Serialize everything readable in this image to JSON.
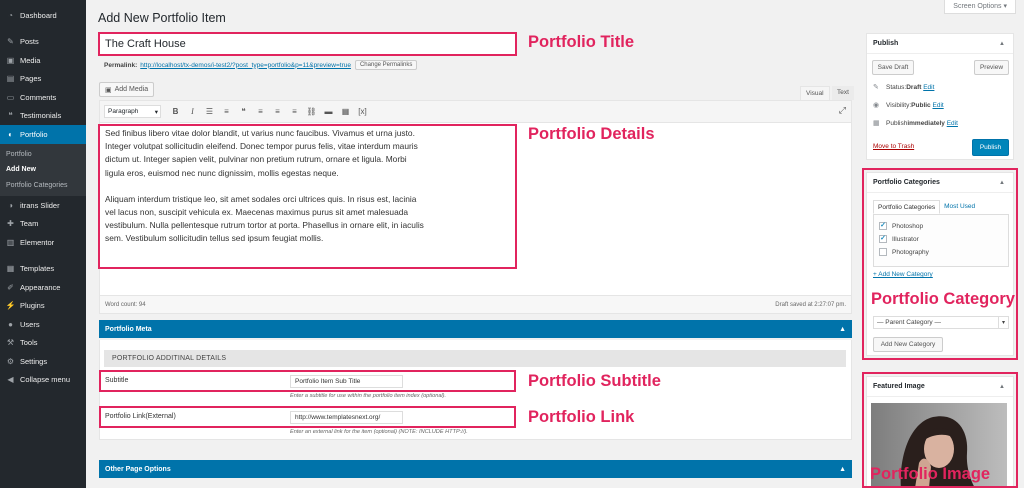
{
  "sidebar": {
    "items": [
      {
        "label": "Dashboard",
        "icon": "dashboard-icon",
        "glyph": "◔"
      },
      {
        "label": "Posts",
        "icon": "pin-icon",
        "glyph": "✎"
      },
      {
        "label": "Media",
        "icon": "media-icon",
        "glyph": "▣"
      },
      {
        "label": "Pages",
        "icon": "page-icon",
        "glyph": "▤"
      },
      {
        "label": "Comments",
        "icon": "comment-icon",
        "glyph": "▭"
      },
      {
        "label": "Testimonials",
        "icon": "testimonial-icon",
        "glyph": "❝"
      },
      {
        "label": "Portfolio",
        "icon": "portfolio-icon",
        "glyph": "◐"
      },
      {
        "label": "itrans Slider",
        "icon": "slider-icon",
        "glyph": "◑"
      },
      {
        "label": "Team",
        "icon": "team-icon",
        "glyph": "✚"
      },
      {
        "label": "Elementor",
        "icon": "elementor-icon",
        "glyph": "▥"
      },
      {
        "label": "Templates",
        "icon": "templates-icon",
        "glyph": "▦"
      },
      {
        "label": "Appearance",
        "icon": "brush-icon",
        "glyph": "✐"
      },
      {
        "label": "Plugins",
        "icon": "plug-icon",
        "glyph": "⚡"
      },
      {
        "label": "Users",
        "icon": "user-icon",
        "glyph": "●"
      },
      {
        "label": "Tools",
        "icon": "wrench-icon",
        "glyph": "⚒"
      },
      {
        "label": "Settings",
        "icon": "settings-icon",
        "glyph": "⚙"
      },
      {
        "label": "Collapse menu",
        "icon": "collapse-icon",
        "glyph": "◀"
      }
    ],
    "submenu": [
      "Portfolio",
      "Add New",
      "Portfolio Categories"
    ]
  },
  "header": {
    "title": "Add New Portfolio Item",
    "screen_options": "Screen Options ▾"
  },
  "post": {
    "title": "The Craft House",
    "permalink_label": "Permalink:",
    "permalink_url": "http://localhost/tx-demos/i-test2/?post_type=portfolio&p=11&preview=true",
    "change_permalinks": "Change Permalinks"
  },
  "editor": {
    "add_media": "Add Media",
    "tab_visual": "Visual",
    "tab_text": "Text",
    "format": "Paragraph",
    "paragraphs": [
      "Sed finibus libero vitae dolor blandit, ut varius nunc faucibus. Vivamus et urna justo. Integer volutpat sollicitudin eleifend. Donec tempor purus felis, vitae interdum mauris dictum ut. Integer sapien velit, pulvinar non pretium rutrum, ornare et ligula. Morbi ligula eros, euismod nec nunc dignissim, mollis egestas neque.",
      "Aliquam interdum tristique leo, sit amet sodales orci ultrices quis. In risus est, lacinia vel lacus non, suscipit vehicula ex. Maecenas maximus purus sit amet malesuada vestibulum. Nulla pellentesque rutrum tortor at porta. Phasellus in ornare elit, in iaculis sem. Vestibulum sollicitudin tellus sed ipsum feugiat mollis."
    ],
    "word_count": "Word count: 94",
    "draft_saved": "Draft saved at 2:27:07 pm."
  },
  "portfolio_meta": {
    "title": "Portfolio Meta",
    "subheading": "PORTFOLIO ADDITINAL DETAILS",
    "subtitle_label": "Subtitle",
    "subtitle_value": "Portfolio Item Sub Title",
    "subtitle_help": "Enter a subtitle for use within the portfolio item index (optional).",
    "link_label": "Portfolio Link(External)",
    "link_value": "http://www.templatesnext.org/",
    "link_help": "Enter an external link for the item (optional) (NOTE: INCLUDE HTTP://)."
  },
  "other_page_options": {
    "title": "Other Page Options"
  },
  "publish": {
    "title": "Publish",
    "save_draft": "Save Draft",
    "preview": "Preview",
    "status_label": "Status: ",
    "status_value": "Draft",
    "visibility_label": "Visibility: ",
    "visibility_value": "Public",
    "publish_label": "Publish ",
    "publish_value": "immediately",
    "edit": "Edit",
    "trash": "Move to Trash",
    "publish_btn": "Publish"
  },
  "categories": {
    "title": "Portfolio Categories",
    "tab_all": "Portfolio Categories",
    "tab_used": "Most Used",
    "items": [
      {
        "label": "Photoshop",
        "checked": "✓"
      },
      {
        "label": "Illustrator",
        "checked": "✓"
      },
      {
        "label": "Photography",
        "checked": ""
      }
    ],
    "add_link": "+ Add New Category",
    "parent_select": "— Parent Category —",
    "add_button": "Add New Category"
  },
  "featured_image": {
    "title": "Featured Image"
  },
  "annotations": {
    "title": "Portfolio Title",
    "details": "Portfolio Details",
    "category": "Portfolio Category",
    "subtitle": "Portfolio Subtitle",
    "link": "Portfolio Link",
    "image": "Portfolio Image"
  },
  "colors": {
    "accent": "#0073aa",
    "annotation": "#e1245e",
    "sidebar": "#23282d"
  }
}
